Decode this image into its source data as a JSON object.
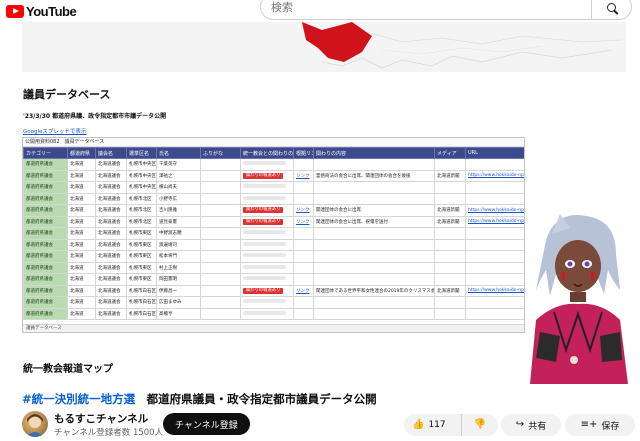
{
  "header": {
    "logo_text": "YouTube",
    "search_placeholder": "検索"
  },
  "video": {
    "section_title": "議員データベース",
    "subtitle": "'23/3/30 都道府県議、政令指定都市市議データ公開",
    "sheet_link": "Googleスプレッドで表示",
    "sheet_tab": "公開用資料082　議員データベース",
    "columns": [
      "カテゴリー",
      "都道府県",
      "議会名",
      "選挙区名",
      "氏名",
      "ふりがな",
      "統一教会との関わりの有無",
      "根拠リンク",
      "関わりの内容",
      "メディア",
      "URL"
    ],
    "rows": [
      {
        "cat": "都道府県議会",
        "pref": "北海道",
        "assembly": "北海道議会",
        "district": "札幌市中央区",
        "name": "千葉英守",
        "badge": "",
        "link": "",
        "content": "",
        "media": "",
        "url": ""
      },
      {
        "cat": "都道府県議会",
        "pref": "北海道",
        "assembly": "北海道議会",
        "district": "札幌市中央区",
        "name": "澤祐之",
        "badge": "関わりの報道あり",
        "link": "リンク",
        "content": "霊感商法の会合に出席、関連団体の会合を後援",
        "media": "北海道新聞",
        "url": "https://www.hokkaido-np.co.jp/"
      },
      {
        "cat": "都道府県議会",
        "pref": "北海道",
        "assembly": "北海道議会",
        "district": "札幌市中央区",
        "name": "横山尚夫",
        "badge": "",
        "link": "",
        "content": "",
        "media": "",
        "url": ""
      },
      {
        "cat": "都道府県議会",
        "pref": "北海道",
        "assembly": "北海道議会",
        "district": "札幌市北区",
        "name": "小野寺広",
        "badge": "",
        "link": "",
        "content": "",
        "media": "",
        "url": ""
      },
      {
        "cat": "都道府県議会",
        "pref": "北海道",
        "assembly": "北海道議会",
        "district": "札幌市北区",
        "name": "吉川隆雅",
        "badge": "関わりの報道あり",
        "link": "リンク",
        "content": "関連団体の会合に出席",
        "media": "北海道新聞",
        "url": "https://www.hokkaido-np.co.jp/"
      },
      {
        "cat": "都道府県議会",
        "pref": "北海道",
        "assembly": "北海道議会",
        "district": "札幌市北区",
        "name": "道見泰憲",
        "badge": "関わりの報道あり",
        "link": "リンク",
        "content": "関連団体の会合に出席、祝電を送付",
        "media": "北海道新聞",
        "url": "https://www.hokkaido-np.co.jp/"
      },
      {
        "cat": "都道府県議会",
        "pref": "北海道",
        "assembly": "北海道議会",
        "district": "札幌市東区",
        "name": "中野渡志穂",
        "badge": "",
        "link": "",
        "content": "",
        "media": "",
        "url": ""
      },
      {
        "cat": "都道府県議会",
        "pref": "北海道",
        "assembly": "北海道議会",
        "district": "札幌市東区",
        "name": "渡邊靖司",
        "badge": "",
        "link": "",
        "content": "",
        "media": "",
        "url": ""
      },
      {
        "cat": "都道府県議会",
        "pref": "北海道",
        "assembly": "北海道議会",
        "district": "札幌市東区",
        "name": "松本将門",
        "badge": "",
        "link": "",
        "content": "",
        "media": "",
        "url": ""
      },
      {
        "cat": "都道府県議会",
        "pref": "北海道",
        "assembly": "北海道議会",
        "district": "札幌市東区",
        "name": "村上正樹",
        "badge": "",
        "link": "",
        "content": "",
        "media": "",
        "url": ""
      },
      {
        "cat": "都道府県議会",
        "pref": "北海道",
        "assembly": "北海道議会",
        "district": "札幌市東区",
        "name": "岡田憲明",
        "badge": "",
        "link": "",
        "content": "",
        "media": "",
        "url": ""
      },
      {
        "cat": "都道府県議会",
        "pref": "北海道",
        "assembly": "北海道議会",
        "district": "札幌市白石区",
        "name": "伊藤昌一",
        "badge": "関わりの報道あり",
        "link": "リンク",
        "content": "関連団体である世界平和女性連合の2019年のクリスマス会合に参加",
        "media": "北海道新聞",
        "url": "https://www.hokkaido-np.co.jp/"
      },
      {
        "cat": "都道府県議会",
        "pref": "北海道",
        "assembly": "北海道議会",
        "district": "札幌市白石区",
        "name": "広田まゆみ",
        "badge": "",
        "link": "",
        "content": "",
        "media": "",
        "url": ""
      },
      {
        "cat": "都道府県議会",
        "pref": "北海道",
        "assembly": "北海道議会",
        "district": "札幌市白石区",
        "name": "髙橋亨",
        "badge": "",
        "link": "",
        "content": "",
        "media": "",
        "url": ""
      }
    ],
    "sheet_footer": "議員データベース",
    "section2_title": "統一教会報道マップ"
  },
  "title": {
    "hashtag": "#統一決別統一地方選",
    "text": "都道府県議員・政令指定都市議員データ公開"
  },
  "channel": {
    "name": "もるすこチャンネル",
    "subscribers": "チャンネル登録者数 1500人",
    "subscribe_label": "チャンネル登録"
  },
  "actions": {
    "like_count": "117",
    "share_label": "共有",
    "save_label": "保存"
  },
  "colors": {
    "brand_red": "#ff0000",
    "header_blue": "#3c4a8c",
    "category_green": "#b9dbb0",
    "badge_red": "#dd3333"
  }
}
